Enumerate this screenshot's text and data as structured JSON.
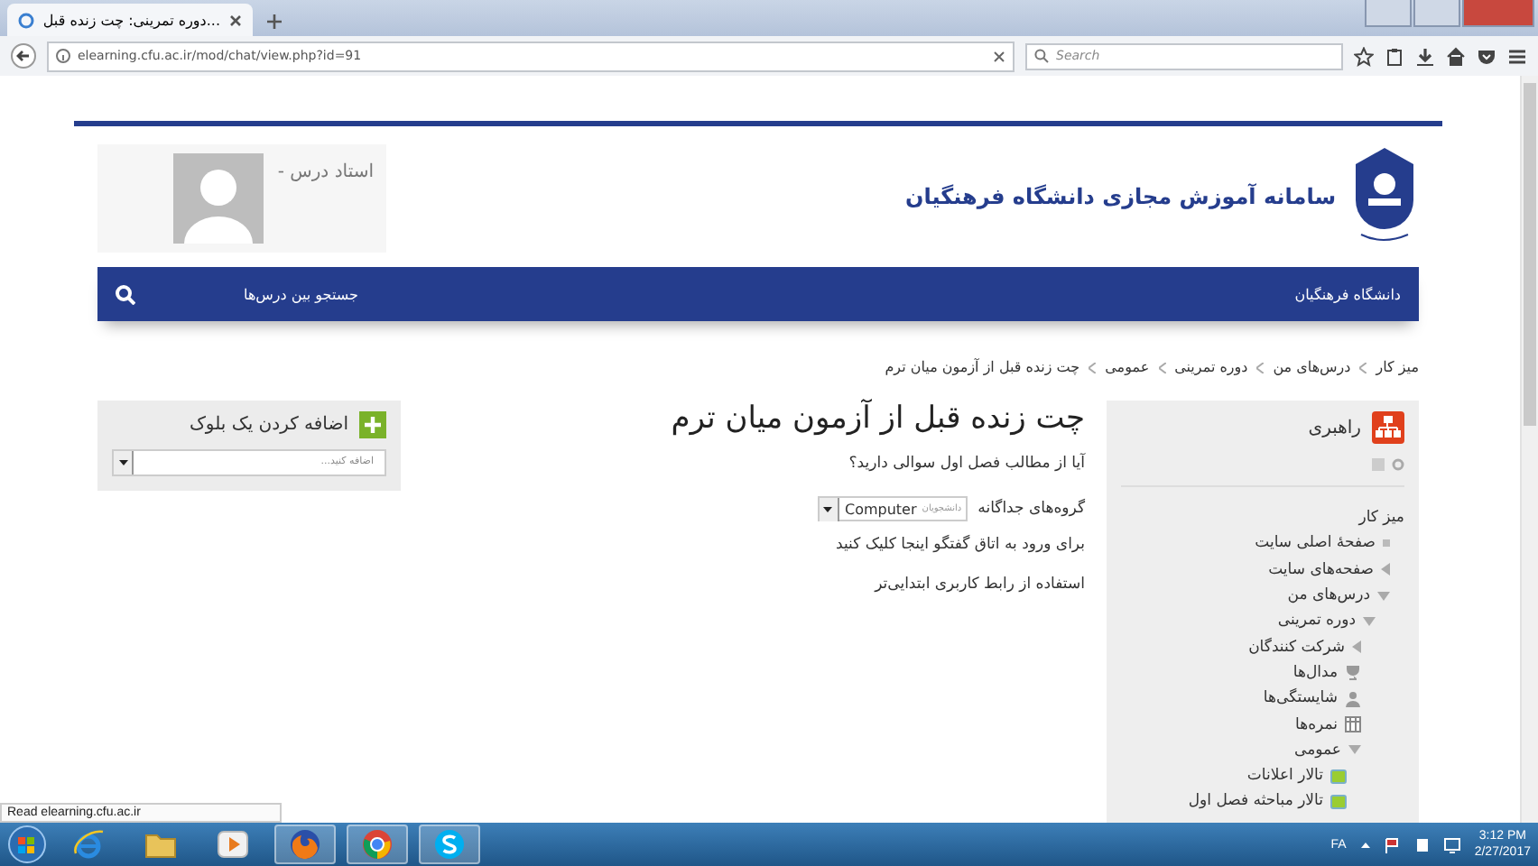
{
  "browser": {
    "tab_title": "...دوره تمرینی: چت زنده قبل",
    "url": "elearning.cfu.ac.ir/mod/chat/view.php?id=91",
    "search_placeholder": "Search"
  },
  "header": {
    "site_title": "سامانه آموزش مجازی دانشگاه فرهنگیان",
    "user_name": "استاد درس -"
  },
  "navbar": {
    "home_link": "دانشگاه فرهنگیان",
    "search_placeholder": "جستجو بین درس‌ها"
  },
  "breadcrumb": [
    "میز کار",
    "درس‌های من",
    "دوره تمرینی",
    "عمومی",
    "چت زنده قبل از آزمون میان ترم"
  ],
  "navigation_block": {
    "title": "راهبری",
    "items": [
      {
        "label": "میز کار",
        "children": [
          {
            "label": "صفحهٔ اصلی سایت",
            "kind": "bullet"
          },
          {
            "label": "صفحه‌های سایت",
            "kind": "branch",
            "expanded": false
          },
          {
            "label": "درس‌های من",
            "kind": "branch",
            "expanded": true,
            "children": [
              {
                "label": "دوره تمرینی",
                "kind": "branch",
                "expanded": true,
                "children": [
                  {
                    "label": "شرکت کنندگان",
                    "kind": "branch",
                    "expanded": false
                  },
                  {
                    "label": "مدال‌ها",
                    "kind": "trophy"
                  },
                  {
                    "label": "شایستگی‌ها",
                    "kind": "person"
                  },
                  {
                    "label": "نمره‌ها",
                    "kind": "grid"
                  },
                  {
                    "label": "عمومی",
                    "kind": "branch",
                    "expanded": true,
                    "children": [
                      {
                        "label": "تالار اعلانات",
                        "kind": "forum"
                      },
                      {
                        "label": "تالار مباحثه فصل اول",
                        "kind": "forum"
                      }
                    ]
                  }
                ]
              }
            ]
          }
        ]
      }
    ]
  },
  "main": {
    "title": "چت زنده قبل از آزمون میان ترم",
    "intro": "آیا از مطالب فصل اول سوالی دارید؟",
    "groups_label": "گروه‌های جداگانه",
    "group_prefix": "دانشجویان",
    "group_value": "Computer",
    "enter_link": "برای ورود به اتاق گفتگو اینجا کلیک کنید",
    "simple_link": "استفاده از رابط کاربری ابتدایی‌تر"
  },
  "add_block": {
    "title": "اضافه کردن یک بلوک",
    "placeholder": "اضافه کنید..."
  },
  "status_text": "Read elearning.cfu.ac.ir",
  "taskbar": {
    "apps": [
      {
        "kind": "ie",
        "running": false
      },
      {
        "kind": "folder",
        "running": false
      },
      {
        "kind": "media",
        "running": false
      },
      {
        "kind": "firefox",
        "running": true
      },
      {
        "kind": "chrome",
        "running": true
      },
      {
        "kind": "skype",
        "running": true
      }
    ],
    "language": "FA",
    "time": "3:12 PM",
    "date": "2/27/2017"
  }
}
